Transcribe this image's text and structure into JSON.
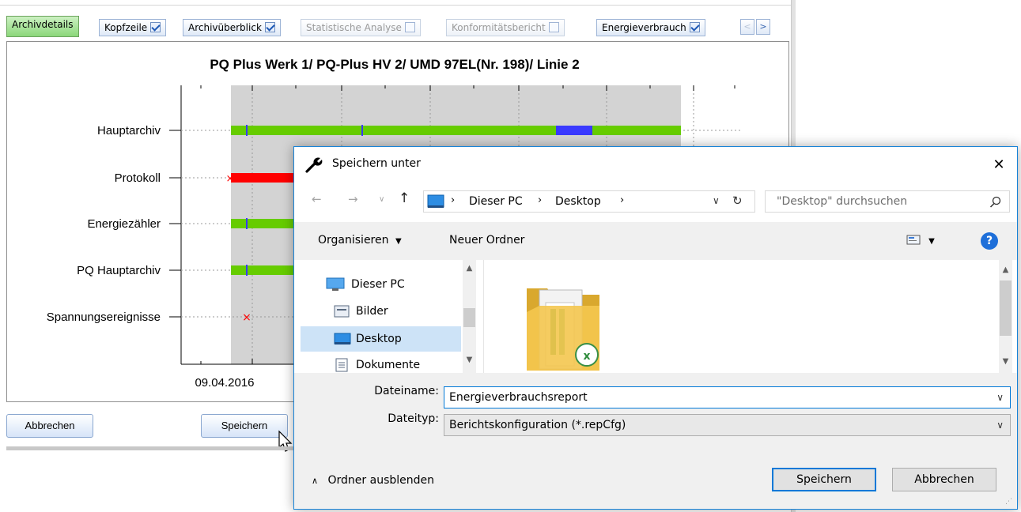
{
  "app": {
    "tabs": [
      {
        "label": "Archivdetails",
        "active": true,
        "checkbox": null
      },
      {
        "label": "Kopfzeile",
        "active": false,
        "checkbox": "checked"
      },
      {
        "label": "Archivüberblick",
        "active": false,
        "checkbox": "checked"
      },
      {
        "label": "Statistische Analyse",
        "active": false,
        "checkbox": "unchecked",
        "disabled": true
      },
      {
        "label": "Konformitätsbericht",
        "active": false,
        "checkbox": "unchecked",
        "disabled": true
      },
      {
        "label": "Energieverbrauch",
        "active": false,
        "checkbox": "checked"
      }
    ],
    "tab_scroll_left": "<",
    "tab_scroll_right": ">",
    "buttons": {
      "cancel_label": "Abbrechen",
      "save_label": "Speichern"
    }
  },
  "chart_data": {
    "type": "timeline",
    "title": "PQ Plus Werk 1/ PQ-Plus HV 2/ UMD 97EL(Nr. 198)/ Linie 2",
    "categories": [
      "Hauptarchiv",
      "Protokoll",
      "Energiezähler",
      "PQ Hauptarchiv",
      "Spannungsereignisse"
    ],
    "x_tick_labels": [
      "09.04.2016"
    ],
    "grid": true,
    "colors": {
      "archive_bar": "#66cc00",
      "protocol_bar": "#ff0000",
      "marker_blue": "#3a3aff",
      "event_marker": "#ff0000",
      "shaded_region": "#d3d3d3"
    }
  },
  "dialog": {
    "title": "Speichern unter",
    "breadcrumb": [
      "Dieser PC",
      "Desktop"
    ],
    "search_placeholder": "\"Desktop\" durchsuchen",
    "toolbar": {
      "organize_label": "Organisieren",
      "new_folder_label": "Neuer Ordner",
      "help_label": "?"
    },
    "nav_items": [
      {
        "label": "Dieser PC",
        "icon": "computer-icon"
      },
      {
        "label": "Bilder",
        "icon": "pictures-icon"
      },
      {
        "label": "Desktop",
        "icon": "desktop-icon",
        "selected": true
      },
      {
        "label": "Dokumente",
        "icon": "documents-icon"
      }
    ],
    "filename_label": "Dateiname:",
    "filename_value": "Energieverbrauchsreport",
    "filetype_label": "Dateityp:",
    "filetype_value": "Berichtskonfiguration (*.repCfg)",
    "hide_folders_label": "Ordner ausblenden",
    "save_label": "Speichern",
    "cancel_label": "Abbrechen"
  }
}
